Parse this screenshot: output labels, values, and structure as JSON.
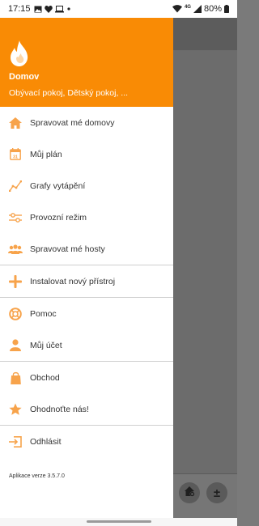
{
  "status_bar": {
    "time": "17:15",
    "network": "4G",
    "battery": "80%"
  },
  "drawer": {
    "home_name": "Domov",
    "rooms": "Obývací pokoj, Dětský pokoj, ...",
    "menu": [
      {
        "label": "Spravovat mé domovy",
        "icon": "home-icon"
      },
      {
        "label": "Můj plán",
        "icon": "calendar-icon"
      },
      {
        "label": "Grafy vytápění",
        "icon": "chart-line-icon"
      },
      {
        "label": "Provozní režim",
        "icon": "sliders-icon"
      },
      {
        "label": "Spravovat mé hosty",
        "icon": "guests-icon"
      },
      {
        "label": "Instalovat nový přístroj",
        "icon": "plus-icon"
      },
      {
        "label": "Pomoc",
        "icon": "lifebuoy-icon"
      },
      {
        "label": "Můj účet",
        "icon": "user-icon"
      },
      {
        "label": "Obchod",
        "icon": "shopping-bag-icon"
      },
      {
        "label": "Ohodnoťte nás!",
        "icon": "star-icon"
      },
      {
        "label": "Odhlásit",
        "icon": "logout-icon"
      }
    ],
    "version": "Aplikace verze 3.5.7.0"
  },
  "background_app": {
    "fab_right_label": "±"
  },
  "colors": {
    "accent": "#F98B05",
    "icon_orange": "#F7A34B"
  }
}
